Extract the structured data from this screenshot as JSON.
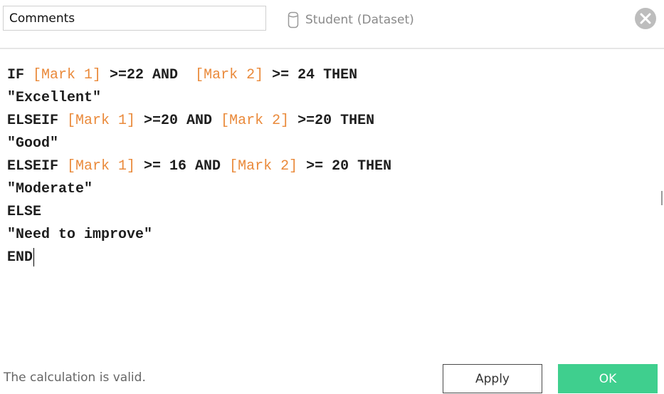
{
  "calculation": {
    "name": "Comments"
  },
  "datasource": {
    "icon": "database-icon",
    "name": "Student",
    "qualifier": "(Dataset)"
  },
  "close": {
    "icon": "close-icon"
  },
  "formula": {
    "lines": [
      [
        {
          "text": "IF ",
          "kind": "keyword"
        },
        {
          "text": "[Mark 1]",
          "kind": "field"
        },
        {
          "text": " >=22 AND  ",
          "kind": "keyword"
        },
        {
          "text": "[Mark 2]",
          "kind": "field"
        },
        {
          "text": " >= 24 THEN",
          "kind": "keyword"
        }
      ],
      [
        {
          "text": "\"Excellent\"",
          "kind": "keyword"
        }
      ],
      [
        {
          "text": "ELSEIF ",
          "kind": "keyword"
        },
        {
          "text": "[Mark 1]",
          "kind": "field"
        },
        {
          "text": " >=20 AND ",
          "kind": "keyword"
        },
        {
          "text": "[Mark 2]",
          "kind": "field"
        },
        {
          "text": " >=20 THEN",
          "kind": "keyword"
        }
      ],
      [
        {
          "text": "\"Good\"",
          "kind": "keyword"
        }
      ],
      [
        {
          "text": "ELSEIF ",
          "kind": "keyword"
        },
        {
          "text": "[Mark 1]",
          "kind": "field"
        },
        {
          "text": " >= 16 AND ",
          "kind": "keyword"
        },
        {
          "text": "[Mark 2]",
          "kind": "field"
        },
        {
          "text": " >= 20 THEN",
          "kind": "keyword"
        }
      ],
      [
        {
          "text": "\"Moderate\"",
          "kind": "keyword"
        }
      ],
      [
        {
          "text": "ELSE",
          "kind": "keyword"
        }
      ],
      [
        {
          "text": "\"Need to improve\"",
          "kind": "keyword"
        }
      ],
      [
        {
          "text": "END",
          "kind": "keyword"
        }
      ]
    ]
  },
  "status": {
    "message": "The calculation is valid."
  },
  "buttons": {
    "apply": "Apply",
    "ok": "OK"
  },
  "colors": {
    "field": "#ea8a3b",
    "keyword": "#1e1e1e",
    "ok_button": "#3fcf8e",
    "close_icon": "#bdbdbd"
  }
}
